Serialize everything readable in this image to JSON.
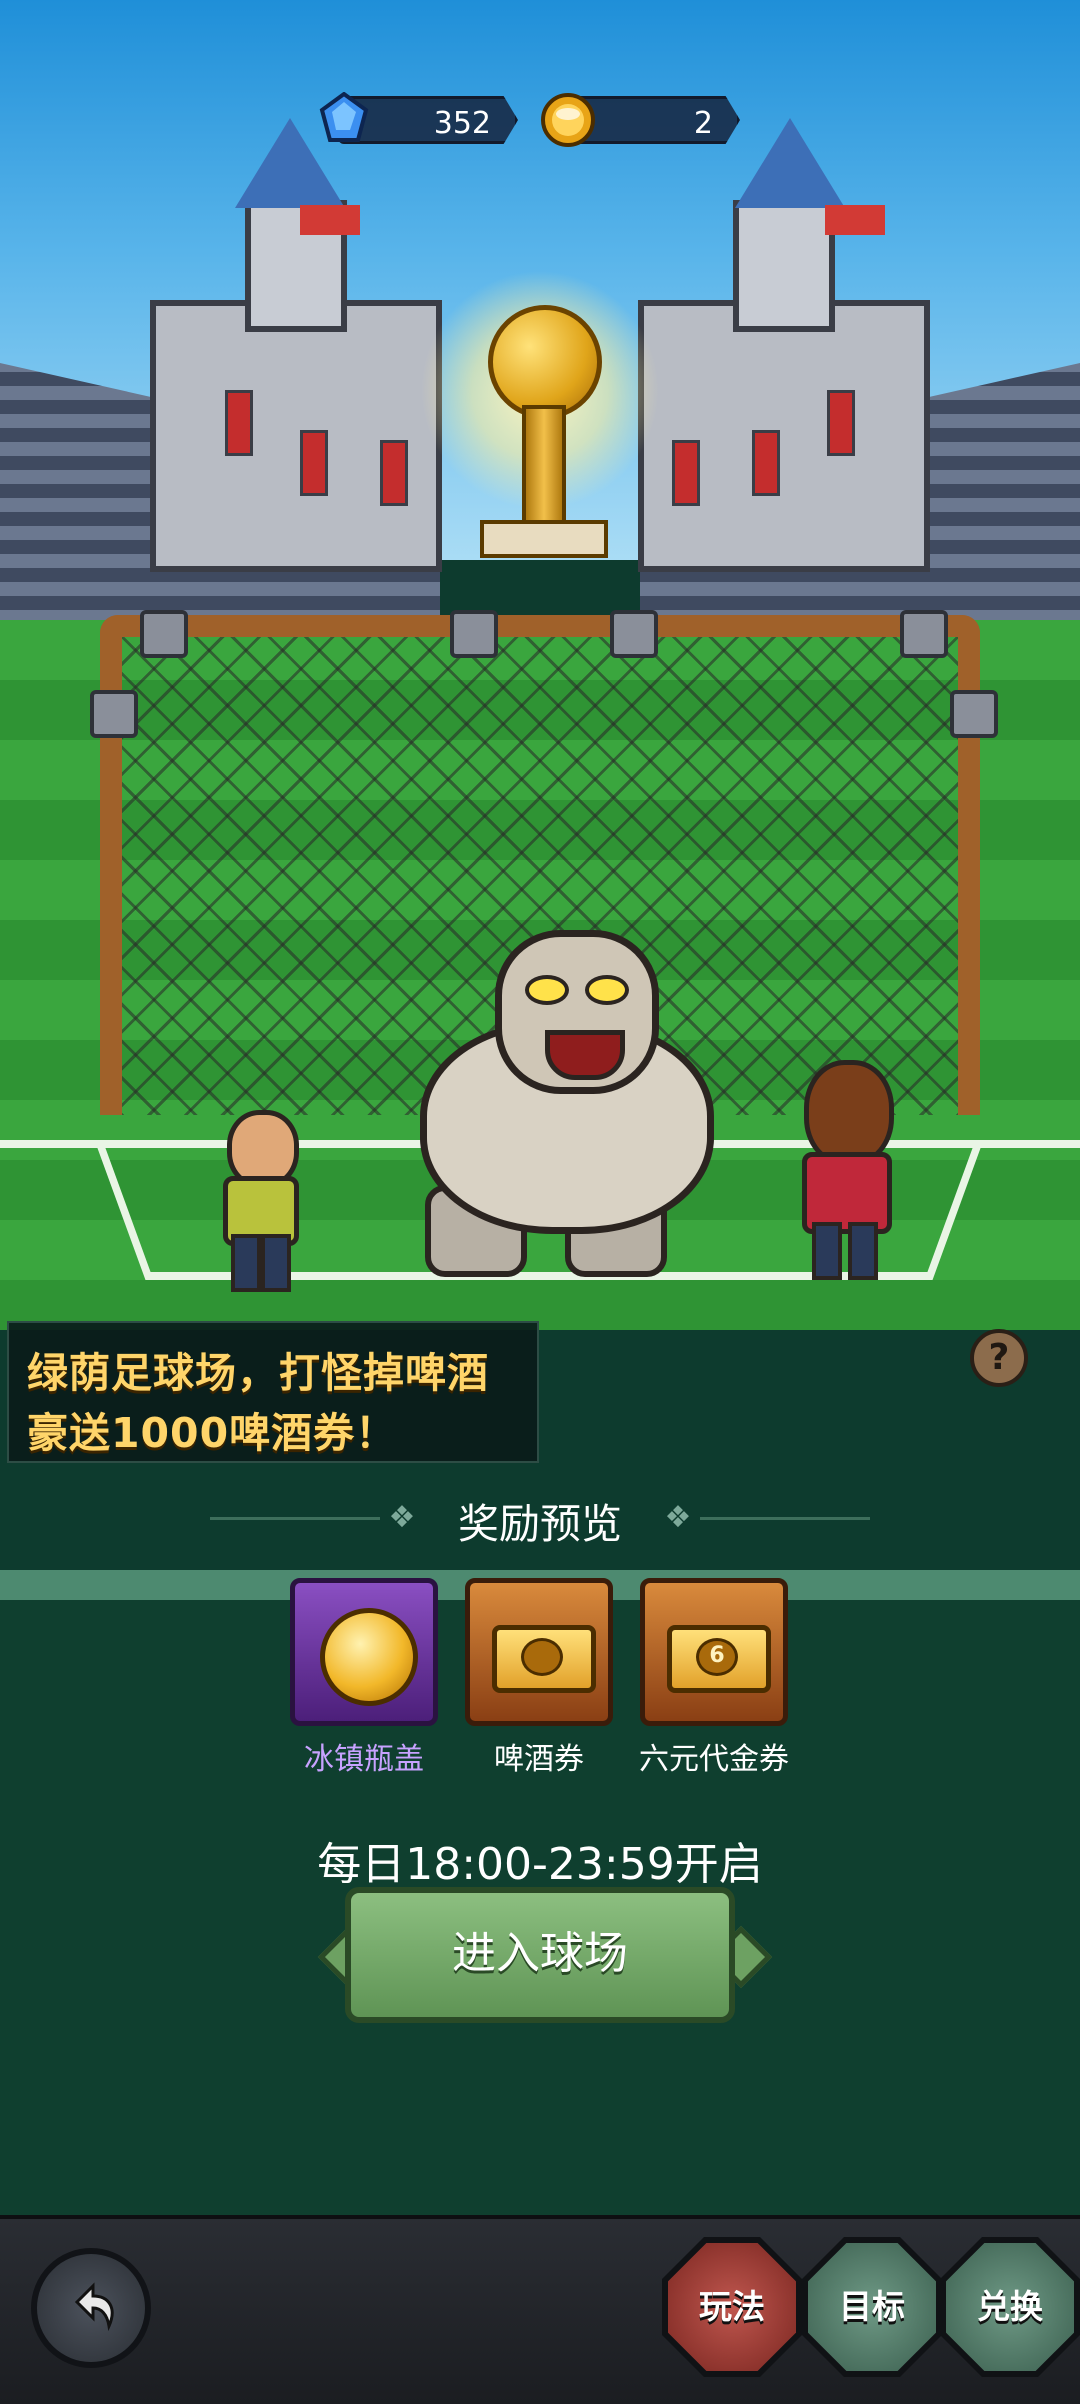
{
  "currencies": [
    {
      "icon": "gem-icon",
      "value": "352"
    },
    {
      "icon": "beer-cap-icon",
      "value": "2"
    }
  ],
  "promo": {
    "line1": "绿荫足球场，打怪掉啤酒",
    "line2": "豪送1000啤酒券！"
  },
  "help_label": "?",
  "rewards": {
    "title": "奖励预览",
    "items": [
      {
        "label": "冰镇瓶盖",
        "icon": "beer-cap-icon",
        "color": "#8a4fc2"
      },
      {
        "label": "啤酒券",
        "icon": "beer-ticket-icon",
        "color": "#d98a3c"
      },
      {
        "label": "六元代金券",
        "icon": "six-voucher-icon",
        "color": "#d98a3c",
        "badge": "6"
      }
    ]
  },
  "schedule": "每日18:00-23:59开启",
  "enter_button": "进入球场",
  "bottom_bar": {
    "back_icon": "back-arrow-icon",
    "buttons": [
      "玩法",
      "目标",
      "兑换"
    ]
  }
}
